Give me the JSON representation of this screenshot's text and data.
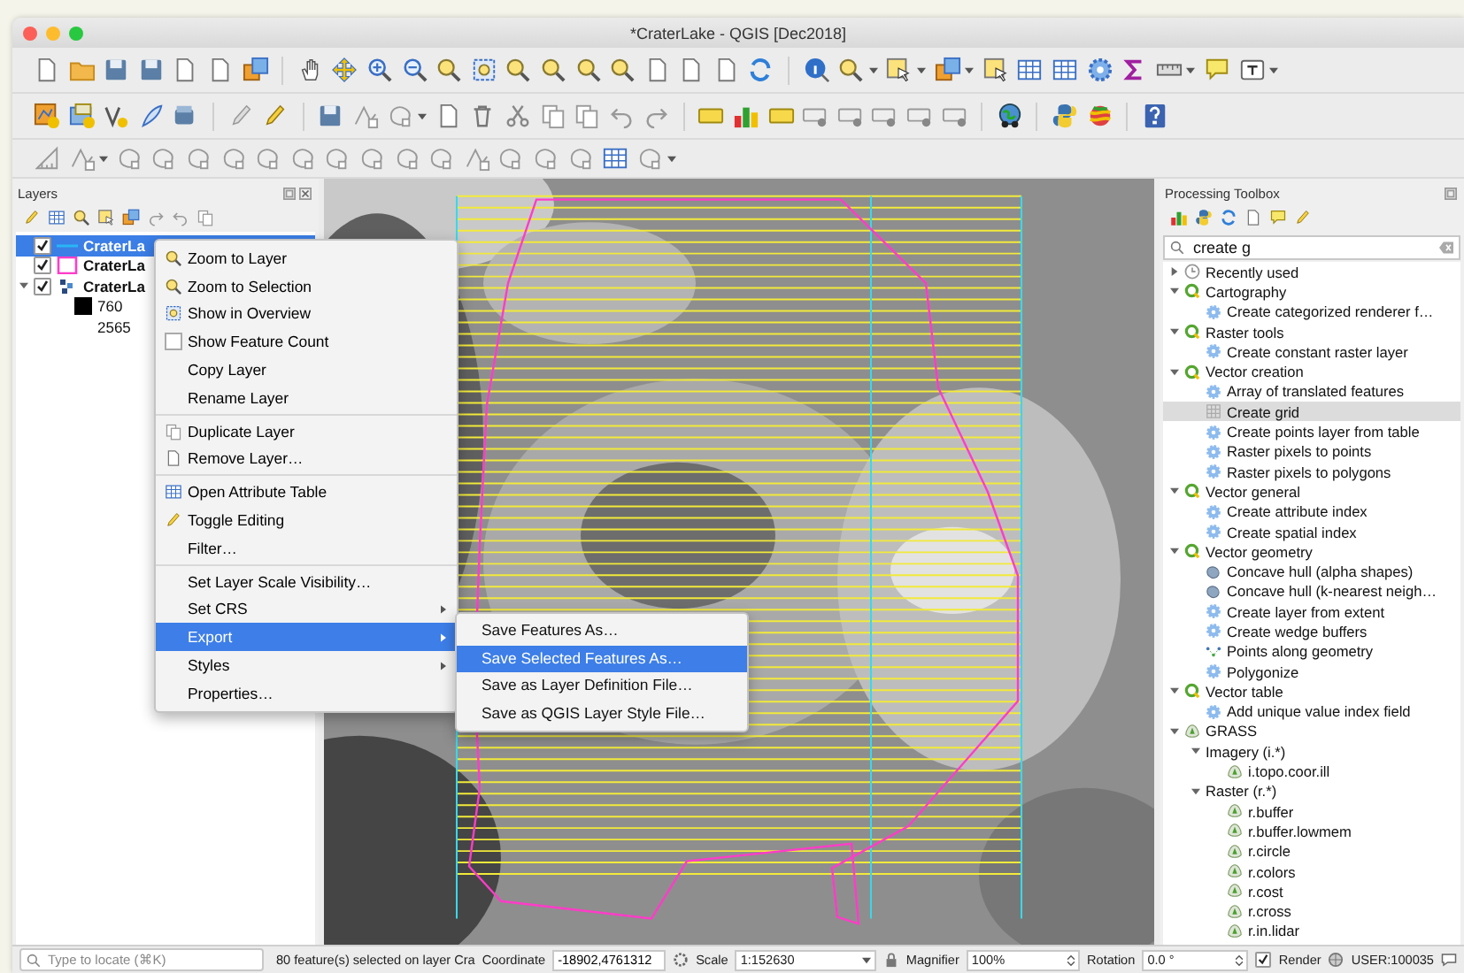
{
  "window": {
    "title": "*CraterLake - QGIS [Dec2018]"
  },
  "layers_panel": {
    "title": "Layers",
    "layers": [
      {
        "name": "CraterLa",
        "kind": "line",
        "checked": true,
        "selected": true
      },
      {
        "name": "CraterLa",
        "kind": "polygon",
        "checked": true,
        "selected": false
      },
      {
        "name": "CraterLa",
        "kind": "raster",
        "checked": true,
        "selected": false,
        "expanded": true,
        "legend": [
          {
            "label": "760",
            "color": "#000000"
          },
          {
            "label": "2565"
          }
        ]
      }
    ]
  },
  "context_menu": {
    "sections": [
      [
        {
          "label": "Zoom to Layer",
          "kind": "zoom",
          "selected": false
        },
        {
          "label": "Zoom to Selection",
          "kind": "zoom-selection",
          "selected": false
        },
        {
          "label": "Show in Overview",
          "kind": "overview",
          "selected": false
        },
        {
          "label": "Show Feature Count",
          "kind": "checkbox",
          "checked": false,
          "selected": false
        },
        {
          "label": "Copy Layer",
          "kind": "plain",
          "selected": false
        },
        {
          "label": "Rename Layer",
          "kind": "plain",
          "selected": false
        }
      ],
      [
        {
          "label": "Duplicate Layer",
          "kind": "duplicate",
          "selected": false
        },
        {
          "label": "Remove Layer…",
          "kind": "remove",
          "selected": false
        }
      ],
      [
        {
          "label": "Open Attribute Table",
          "kind": "table",
          "selected": false
        },
        {
          "label": "Toggle Editing",
          "kind": "pencil",
          "selected": false
        },
        {
          "label": "Filter…",
          "kind": "plain",
          "selected": false
        }
      ],
      [
        {
          "label": "Set Layer Scale Visibility…",
          "kind": "plain",
          "selected": false
        },
        {
          "label": "Set CRS",
          "kind": "plain",
          "submenu": true,
          "selected": false
        },
        {
          "label": "Export",
          "kind": "plain",
          "submenu": true,
          "selected": true
        },
        {
          "label": "Styles",
          "kind": "plain",
          "submenu": true,
          "selected": false
        },
        {
          "label": "Properties…",
          "kind": "plain",
          "selected": false
        }
      ]
    ],
    "submenu": [
      {
        "label": "Save Features As…",
        "selected": false
      },
      {
        "label": "Save Selected Features As…",
        "selected": true
      },
      {
        "label": "Save as Layer Definition File…",
        "selected": false
      },
      {
        "label": "Save as QGIS Layer Style File…",
        "selected": false
      }
    ]
  },
  "toolbox": {
    "title": "Processing Toolbox",
    "search": {
      "value": "create g"
    },
    "tree": [
      {
        "label": "Recently used",
        "kind": "recent",
        "expanded": false,
        "selected": false
      },
      {
        "label": "Cartography",
        "kind": "group",
        "expanded": true,
        "selected": false,
        "children": [
          {
            "label": "Create categorized renderer f…",
            "kind": "gear",
            "selected": false
          }
        ]
      },
      {
        "label": "Raster tools",
        "kind": "group",
        "expanded": true,
        "selected": false,
        "children": [
          {
            "label": "Create constant raster layer",
            "kind": "gear",
            "selected": false
          }
        ]
      },
      {
        "label": "Vector creation",
        "kind": "group",
        "expanded": true,
        "selected": false,
        "children": [
          {
            "label": "Array of translated features",
            "kind": "gear",
            "selected": false
          },
          {
            "label": "Create grid",
            "kind": "grid",
            "selected": true
          },
          {
            "label": "Create points layer from table",
            "kind": "gear",
            "selected": false
          },
          {
            "label": "Raster pixels to points",
            "kind": "gear",
            "selected": false
          },
          {
            "label": "Raster pixels to polygons",
            "kind": "gear",
            "selected": false
          }
        ]
      },
      {
        "label": "Vector general",
        "kind": "group",
        "expanded": true,
        "selected": false,
        "children": [
          {
            "label": "Create attribute index",
            "kind": "gear",
            "selected": false
          },
          {
            "label": "Create spatial index",
            "kind": "gear",
            "selected": false
          }
        ]
      },
      {
        "label": "Vector geometry",
        "kind": "group",
        "expanded": true,
        "selected": false,
        "children": [
          {
            "label": "Concave hull (alpha shapes)",
            "kind": "hull",
            "selected": false
          },
          {
            "label": "Concave hull (k-nearest neigh…",
            "kind": "hull",
            "selected": false
          },
          {
            "label": "Create layer from extent",
            "kind": "gear",
            "selected": false
          },
          {
            "label": "Create wedge buffers",
            "kind": "gear",
            "selected": false
          },
          {
            "label": "Points along geometry",
            "kind": "points",
            "selected": false
          },
          {
            "label": "Polygonize",
            "kind": "gear",
            "selected": false
          }
        ]
      },
      {
        "label": "Vector table",
        "kind": "group",
        "expanded": true,
        "selected": false,
        "children": [
          {
            "label": "Add unique value index field",
            "kind": "gear",
            "selected": false
          }
        ]
      },
      {
        "label": "GRASS",
        "kind": "grass",
        "expanded": true,
        "selected": false,
        "children": [
          {
            "label": "Imagery (i.*)",
            "kind": "folder",
            "expanded": true,
            "selected": false,
            "children": [
              {
                "label": "i.topo.coor.ill",
                "kind": "grass",
                "selected": false
              }
            ]
          },
          {
            "label": "Raster (r.*)",
            "kind": "folder",
            "expanded": true,
            "selected": false,
            "children": [
              {
                "label": "r.buffer",
                "kind": "grass",
                "selected": false
              },
              {
                "label": "r.buffer.lowmem",
                "kind": "grass",
                "selected": false
              },
              {
                "label": "r.circle",
                "kind": "grass",
                "selected": false
              },
              {
                "label": "r.colors",
                "kind": "grass",
                "selected": false
              },
              {
                "label": "r.cost",
                "kind": "grass",
                "selected": false
              },
              {
                "label": "r.cross",
                "kind": "grass",
                "selected": false
              },
              {
                "label": "r.in.lidar",
                "kind": "grass",
                "selected": false
              }
            ]
          }
        ]
      }
    ]
  },
  "status_bar": {
    "locate": {
      "placeholder": "Type to locate (⌘K)"
    },
    "message": "80 feature(s) selected on layer Cra",
    "coordinate_label": "Coordinate",
    "coordinate": "-18902,4761312",
    "scale_label": "Scale",
    "scale": "1:152630",
    "magnifier_label": "Magnifier",
    "magnifier": "100%",
    "rotation_label": "Rotation",
    "rotation": "0.0 °",
    "render": {
      "label": "Render",
      "checked": true
    },
    "crs": "USER:100035"
  }
}
